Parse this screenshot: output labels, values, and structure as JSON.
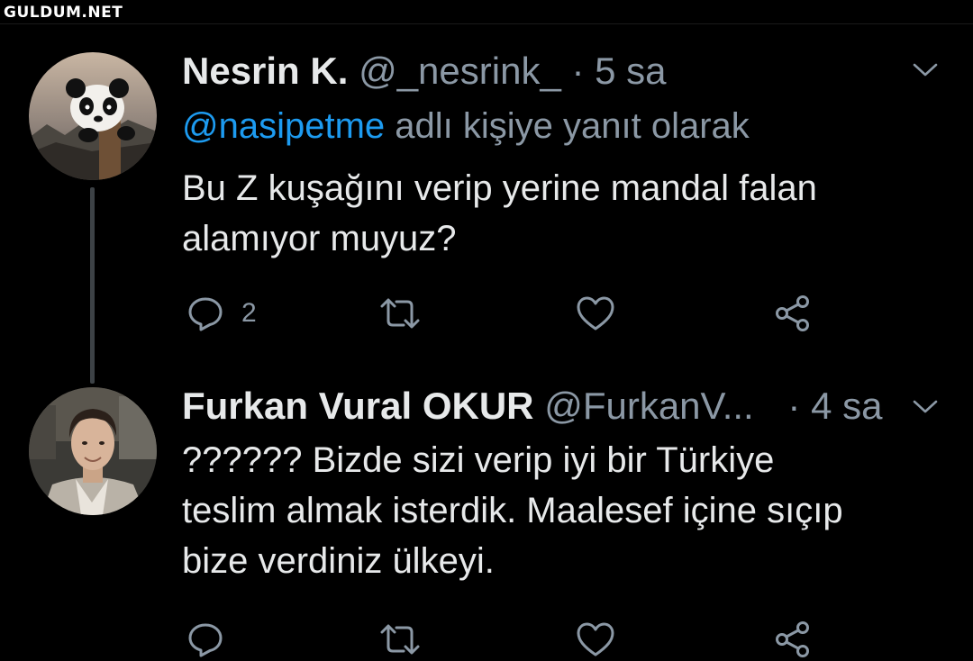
{
  "watermark": "GULDUM.NET",
  "tweets": [
    {
      "name": "Nesrin K.",
      "handle": "@_nesrink_",
      "separator": "·",
      "time": "5 sa",
      "reply_mention": "@nasipetme",
      "reply_suffix": "adlı kişiye yanıt olarak",
      "lines": [
        "Bu Z kuşağını verip yerine mandal falan",
        "alamıyor muyuz?"
      ],
      "reply_count": "2",
      "avatar_icon": "panda-avatar"
    },
    {
      "name": "Furkan Vural OKUR",
      "handle": "@FurkanV...",
      "separator": "·",
      "time": "4 sa",
      "lines": [
        "?????? Bizde sizi verip iyi bir Türkiye",
        "teslim almak isterdik. Maalesef içine sıçıp",
        "bize verdiniz ülkeyi."
      ],
      "reply_count": "",
      "avatar_icon": "person-avatar"
    }
  ],
  "action_icons": [
    "reply-icon",
    "retweet-icon",
    "like-icon",
    "share-icon"
  ],
  "colors": {
    "background": "#000000",
    "text": "#e7e9ea",
    "muted": "#8b98a5",
    "link": "#1d9bf0",
    "thread_line": "#3d4246"
  }
}
